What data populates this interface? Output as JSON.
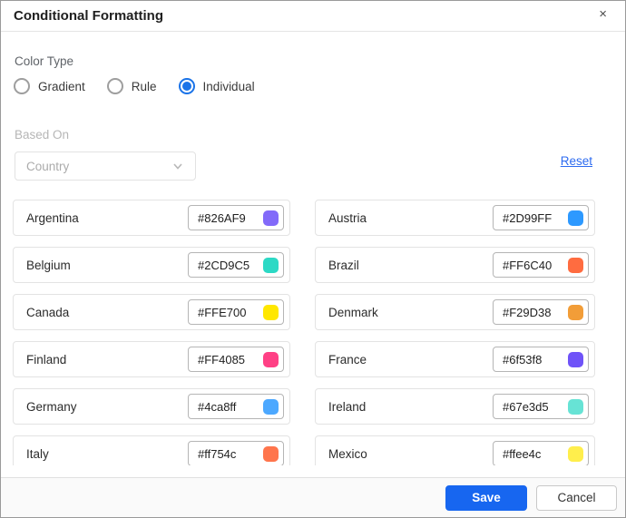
{
  "dialog": {
    "title": "Conditional Formatting",
    "close_icon": "×"
  },
  "color_type": {
    "label": "Color Type",
    "options": [
      {
        "label": "Gradient",
        "selected": false
      },
      {
        "label": "Rule",
        "selected": false
      },
      {
        "label": "Individual",
        "selected": true
      }
    ]
  },
  "based_on": {
    "label": "Based On",
    "value": "Country",
    "disabled": true
  },
  "reset_label": "Reset",
  "colors": {
    "items": [
      {
        "name": "Argentina",
        "hex": "#826AF9"
      },
      {
        "name": "Austria",
        "hex": "#2D99FF"
      },
      {
        "name": "Belgium",
        "hex": "#2CD9C5"
      },
      {
        "name": "Brazil",
        "hex": "#FF6C40"
      },
      {
        "name": "Canada",
        "hex": "#FFE700"
      },
      {
        "name": "Denmark",
        "hex": "#F29D38"
      },
      {
        "name": "Finland",
        "hex": "#FF4085"
      },
      {
        "name": "France",
        "hex": "#6f53f8"
      },
      {
        "name": "Germany",
        "hex": "#4ca8ff"
      },
      {
        "name": "Ireland",
        "hex": "#67e3d5"
      },
      {
        "name": "Italy",
        "hex": "#ff754c"
      },
      {
        "name": "Mexico",
        "hex": "#ffee4c"
      }
    ]
  },
  "footer": {
    "save_label": "Save",
    "cancel_label": "Cancel"
  },
  "theme": {
    "radio_blue": "#1a73e8",
    "save_blue": "#1766f0",
    "link_blue": "#2d6bf0"
  }
}
